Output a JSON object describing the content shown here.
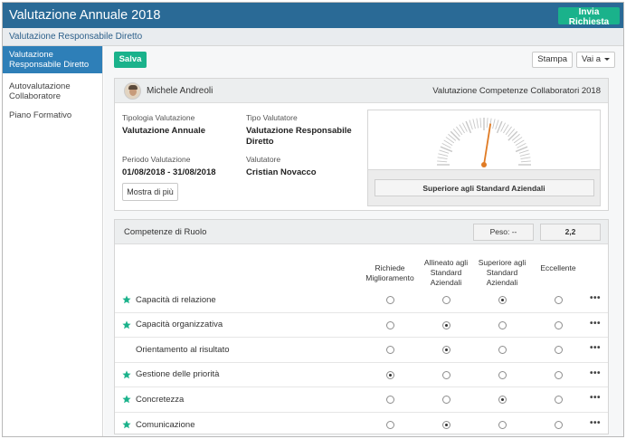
{
  "app": {
    "title": "Valutazione Annuale 2018",
    "submit_label": "Invia Richiesta"
  },
  "breadcrumb": "Valutazione Responsabile Diretto",
  "sidebar": {
    "items": [
      {
        "label": "Valutazione Responsabile Diretto",
        "active": true
      },
      {
        "label": "Autovalutazione Collaboratore",
        "active": false
      },
      {
        "label": "Piano Formativo",
        "active": false
      }
    ]
  },
  "toolbar": {
    "save_label": "Salva",
    "print_label": "Stampa",
    "goto_label": "Vai a"
  },
  "summary": {
    "person_name": "Michele Andreoli",
    "evaluation_title": "Valutazione Competenze Collaboratori 2018",
    "fields": {
      "type_label": "Tipologia Valutazione",
      "type_value": "Valutazione Annuale",
      "evaluator_type_label": "Tipo Valutatore",
      "evaluator_type_value": "Valutazione Responsabile Diretto",
      "period_label": "Periodo Valutazione",
      "period_value": "01/08/2018 - 31/08/2018",
      "evaluator_label": "Valutatore",
      "evaluator_value": "Cristian Novacco"
    },
    "more_label": "Mostra di più",
    "gauge": {
      "result_label": "Superiore agli Standard Aziendali",
      "level": 0.55,
      "needle_color": "#e07b24"
    }
  },
  "competencies": {
    "title": "Competenze di Ruolo",
    "weight_label": "Peso: --",
    "score": "2,2",
    "columns": [
      "Richiede Miglioramento",
      "Allineato agli Standard Aziendali",
      "Superiore agli Standard Aziendali",
      "Eccellente"
    ],
    "menu_icon": "more-dots-icon",
    "star_color": "#1ab28b",
    "rows": [
      {
        "label": "Capacità di relazione",
        "starred": true,
        "selected": 2
      },
      {
        "label": "Capacità organizzativa",
        "starred": true,
        "selected": 1
      },
      {
        "label": "Orientamento al risultato",
        "starred": false,
        "selected": 1
      },
      {
        "label": "Gestione delle priorità",
        "starred": true,
        "selected": 0
      },
      {
        "label": "Concretezza",
        "starred": true,
        "selected": 2
      },
      {
        "label": "Comunicazione",
        "starred": true,
        "selected": 1
      }
    ]
  }
}
